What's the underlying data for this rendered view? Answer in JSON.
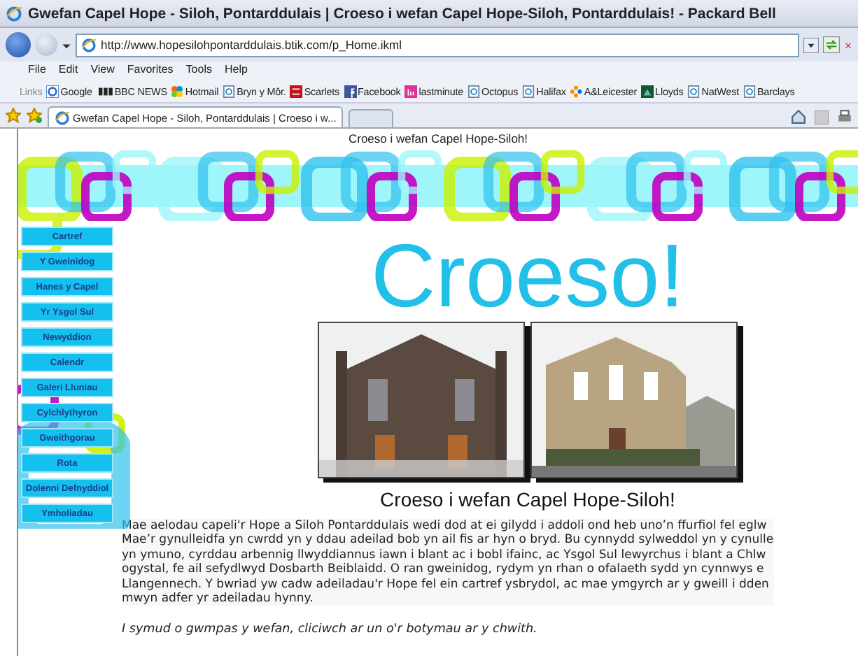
{
  "window": {
    "title": "Gwefan Capel Hope - Siloh, Pontarddulais | Croeso i wefan Capel Hope-Siloh, Pontarddulais! - Packard Bell"
  },
  "address_bar": {
    "url": "http://www.hopesilohpontarddulais.btik.com/p_Home.ikml"
  },
  "menu": [
    "File",
    "Edit",
    "View",
    "Favorites",
    "Tools",
    "Help"
  ],
  "links_bar": {
    "label": "Links",
    "items": [
      {
        "label": "Google",
        "kind": "google"
      },
      {
        "label": "BBC NEWS",
        "kind": "bbc"
      },
      {
        "label": "Hotmail",
        "kind": "msn"
      },
      {
        "label": "Bryn y Môr.",
        "kind": "ie"
      },
      {
        "label": "Scarlets",
        "kind": "scarlets"
      },
      {
        "label": "Facebook",
        "kind": "facebook"
      },
      {
        "label": "lastminute",
        "kind": "lastminute"
      },
      {
        "label": "Octopus",
        "kind": "ie"
      },
      {
        "label": "Halifax",
        "kind": "ie"
      },
      {
        "label": "A&Leicester",
        "kind": "al"
      },
      {
        "label": "Lloyds",
        "kind": "lloyds"
      },
      {
        "label": "NatWest",
        "kind": "ie"
      },
      {
        "label": "Barclays",
        "kind": "ie"
      }
    ]
  },
  "tabs": [
    {
      "label": "Gwefan Capel Hope - Siloh, Pontarddulais | Croeso i w...",
      "selected": true
    }
  ],
  "page": {
    "header_text": "Croeso i wefan Capel Hope-Siloh!",
    "nav": [
      "Cartref",
      "Y Gweinidog",
      "Hanes y Capel",
      "Yr Ysgol Sul",
      "Newyddion",
      "Calendr",
      "Galeri Lluniau",
      "Cylchlythyron",
      "Gweithgorau",
      "Rota",
      "Dolenni Defnyddiol",
      "Ymholiadau"
    ],
    "heading": "Croeso!",
    "photos": [
      {
        "kind": "picture"
      },
      {
        "kind": "picture"
      }
    ],
    "caption": "Croeso i wefan Capel Hope-Siloh!",
    "paragraph_lines": [
      "Mae aelodau capeli'r Hope a Siloh Pontarddulais wedi dod at ei gilydd i addoli ond heb uno’n ffurfiol fel eglw",
      "Mae’r gynulleidfa yn cwrdd yn y ddau adeilad bob yn ail fis ar hyn o bryd. Bu cynnydd sylweddol yn y cynulle",
      "yn ymuno, cyrddau arbennig llwyddiannus iawn i blant ac i bobl ifainc, ac Ysgol Sul lewyrchus i blant a Chlw",
      "ogystal, fe ail sefydlwyd Dosbarth Beiblaidd. O ran gweinidog, rydym yn rhan o ofalaeth sydd yn cynnwys e",
      "Llangennech. Y bwriad yw cadw adeiladau'r Hope fel ein cartref ysbrydol, ac mae ymgyrch ar y gweill i dden",
      "mwyn adfer yr adeiladau hynny."
    ],
    "note": "I symud o gwmpas y wefan, cliciwch ar un o'r botymau ar y chwith."
  }
}
